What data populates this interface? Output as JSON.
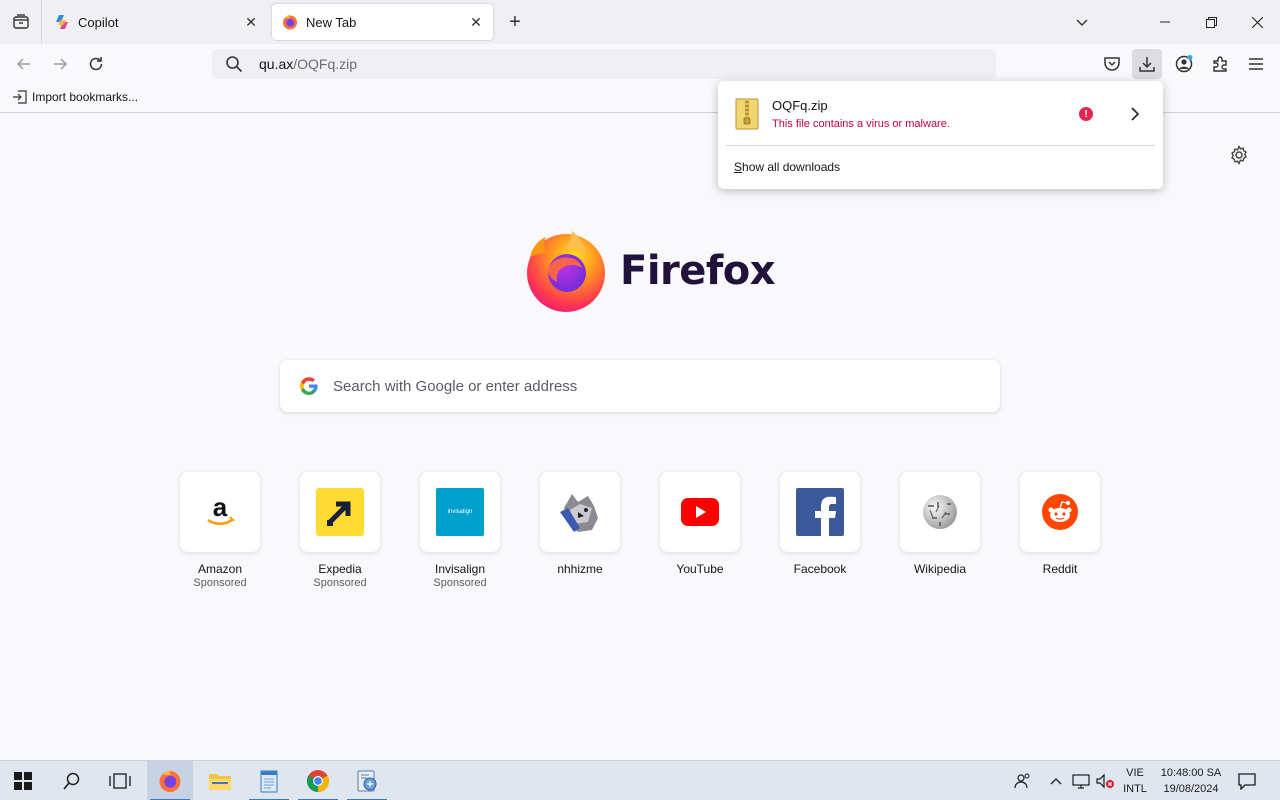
{
  "tabs": [
    {
      "label": "Copilot",
      "active": false
    },
    {
      "label": "New Tab",
      "active": true
    }
  ],
  "close_glyph": "✕",
  "newtab_glyph": "+",
  "urlbar": {
    "host": "qu.ax",
    "path": "/OQFq.zip"
  },
  "bookmarks": {
    "import_label": "Import bookmarks..."
  },
  "newtab": {
    "wordmark": "Firefox",
    "search_placeholder": "Search with Google or enter address"
  },
  "tiles": [
    {
      "name": "Amazon",
      "sponsor": "Sponsored",
      "icon": "amazon-logo"
    },
    {
      "name": "Expedia",
      "sponsor": "Sponsored",
      "icon": "expedia-logo"
    },
    {
      "name": "Invisalign",
      "sponsor": "Sponsored",
      "icon": "invisalign-logo"
    },
    {
      "name": "nhhizme",
      "sponsor": "",
      "icon": "nhhizme-thumbnail"
    },
    {
      "name": "YouTube",
      "sponsor": "",
      "icon": "youtube-logo"
    },
    {
      "name": "Facebook",
      "sponsor": "",
      "icon": "facebook-logo"
    },
    {
      "name": "Wikipedia",
      "sponsor": "",
      "icon": "wikipedia-logo"
    },
    {
      "name": "Reddit",
      "sponsor": "",
      "icon": "reddit-logo"
    }
  ],
  "invisalign_text": "invisalign",
  "downloads": {
    "file_name": "OQFq.zip",
    "status": "This file contains a virus or malware.",
    "warning_glyph": "!",
    "show_all_prefix": "S",
    "show_all_rest": "how all downloads"
  },
  "taskbar": {
    "lang_top": "VIE",
    "lang_bottom": "INTL",
    "time": "10:48:00 SA",
    "date": "19/08/2024"
  },
  "colors": {
    "accent_blue": "#0060df",
    "danger": "#c50042",
    "firefox_wordmark": "#20123a"
  }
}
